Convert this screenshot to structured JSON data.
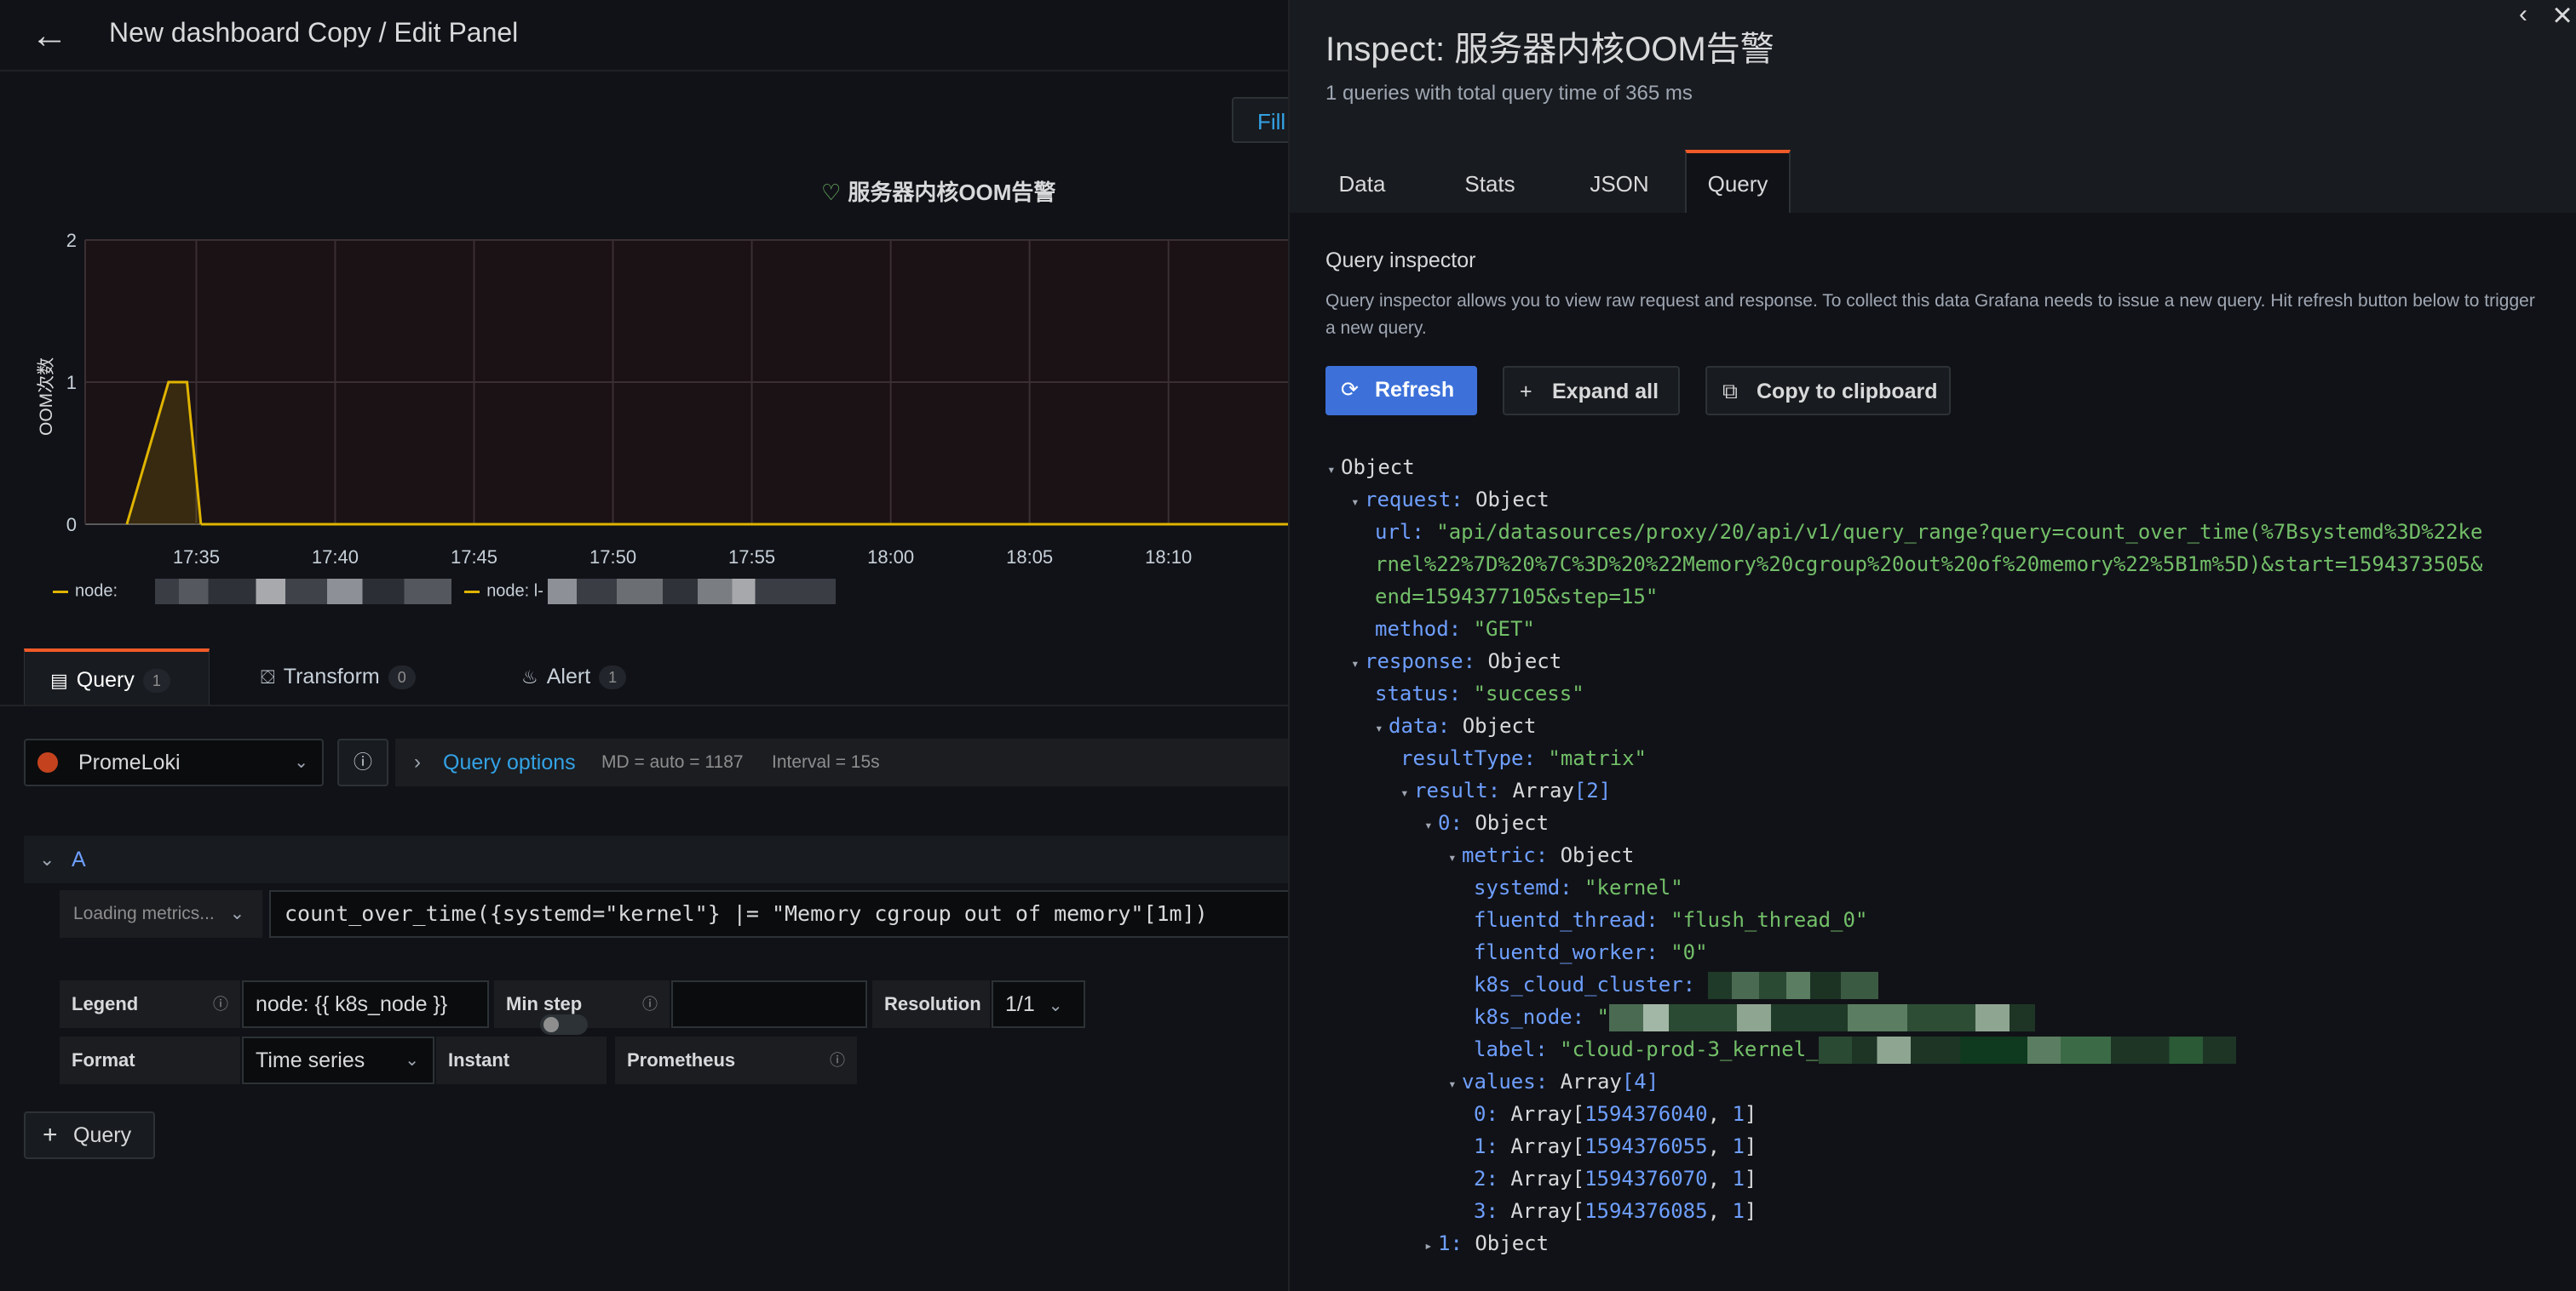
{
  "editor": {
    "title": "New dashboard Copy / Edit Panel",
    "fill_label": "Fill",
    "panel": {
      "title": "服务器内核OOM告警",
      "ylabel": "OOM次数",
      "legend_label_1": "node:",
      "legend_label_2": "node: l-"
    },
    "tabs": [
      {
        "label": "Query",
        "count": "1"
      },
      {
        "label": "Transform",
        "count": "0"
      },
      {
        "label": "Alert",
        "count": "1"
      }
    ],
    "datasource": "PromeLoki",
    "query_options": {
      "label": "Query options",
      "md": "MD = auto = 1187",
      "interval": "Interval = 15s"
    },
    "query": {
      "ref_id": "A",
      "metrics_btn": "Loading metrics...",
      "expr": "count_over_time({systemd=\"kernel\"} |= \"Memory cgroup out of memory\"[1m])",
      "legend_label": "Legend",
      "legend_value": "node: {{ k8s_node }}",
      "min_step_label": "Min step",
      "min_step_value": "",
      "resolution_label": "Resolution",
      "resolution_value": "1/1",
      "format_label": "Format",
      "format_value": "Time series",
      "instant_label": "Instant",
      "instant_on": false,
      "prometheus_label": "Prometheus"
    },
    "add_query_label": "Query"
  },
  "chart_data": {
    "type": "line",
    "title": "服务器内核OOM告警",
    "ylabel": "OOM次数",
    "xlabel": "",
    "ylim": [
      0,
      2
    ],
    "yticks": [
      "0",
      "1",
      "2"
    ],
    "xticks": [
      "17:35",
      "17:40",
      "17:45",
      "17:50",
      "17:55",
      "18:00",
      "18:05",
      "18:10"
    ],
    "x_range_minutes": [
      "17:31",
      "18:14"
    ],
    "grid": true,
    "series": [
      {
        "color": "#e0b400",
        "points": [
          [
            "17:32:30",
            0
          ],
          [
            "17:34:00",
            1
          ],
          [
            "17:34:40",
            1
          ],
          [
            "17:35:10",
            0
          ]
        ]
      }
    ]
  },
  "inspector": {
    "title": "Inspect: 服务器内核OOM告警",
    "subtitle": "1 queries with total query time of 365 ms",
    "tabs": [
      "Data",
      "Stats",
      "JSON",
      "Query"
    ],
    "active_tab": "Query",
    "section_title": "Query inspector",
    "description": "Query inspector allows you to view raw request and response. To collect this data Grafana needs to issue a new query. Hit refresh button below to trigger a new query.",
    "buttons": {
      "refresh": "Refresh",
      "expand_all": "Expand all",
      "copy": "Copy to clipboard"
    },
    "json": {
      "root": "Object",
      "request_key": "request:",
      "request_type": "Object",
      "url_key": "url:",
      "url_line1": "\"api/datasources/proxy/20/api/v1/query_range?query=count_over_time(%7Bsystemd%3D%22ke",
      "url_line2": "rnel%22%7D%20%7C%3D%20%22Memory%20cgroup%20out%20of%20memory%22%5B1m%5D)&start=1594373505&",
      "url_line3": "end=1594377105&step=15\"",
      "method_key": "method:",
      "method_val": "\"GET\"",
      "response_key": "response:",
      "response_type": "Object",
      "status_key": "status:",
      "status_val": "\"success\"",
      "data_key": "data:",
      "data_type": "Object",
      "resultType_key": "resultType:",
      "resultType_val": "\"matrix\"",
      "result_key": "result:",
      "result_type": "Array",
      "result_len": "[2]",
      "item0_key": "0:",
      "item0_type": "Object",
      "metric_key": "metric:",
      "metric_type": "Object",
      "systemd_key": "systemd:",
      "systemd_val": "\"kernel\"",
      "fthread_key": "fluentd_thread:",
      "fthread_val": "\"flush_thread_0\"",
      "fworker_key": "fluentd_worker:",
      "fworker_val": "\"0\"",
      "cluster_key": "k8s_cloud_cluster:",
      "node_key": "k8s_node:",
      "node_val_prefix": "\"",
      "label_key": "label:",
      "label_val_prefix": "\"cloud-prod-3_kernel_",
      "values_key": "values:",
      "values_type": "Array",
      "values_len": "[4]",
      "v0_key": "0:",
      "v0_type": "Array",
      "v0_ts": "1594376040",
      "v0_v": "1",
      "v1_key": "1:",
      "v1_type": "Array",
      "v1_ts": "1594376055",
      "v1_v": "1",
      "v2_key": "2:",
      "v2_type": "Array",
      "v2_ts": "1594376070",
      "v2_v": "1",
      "v3_key": "3:",
      "v3_type": "Array",
      "v3_ts": "1594376085",
      "v3_v": "1",
      "item1_key": "1:",
      "item1_type": "Object"
    }
  }
}
